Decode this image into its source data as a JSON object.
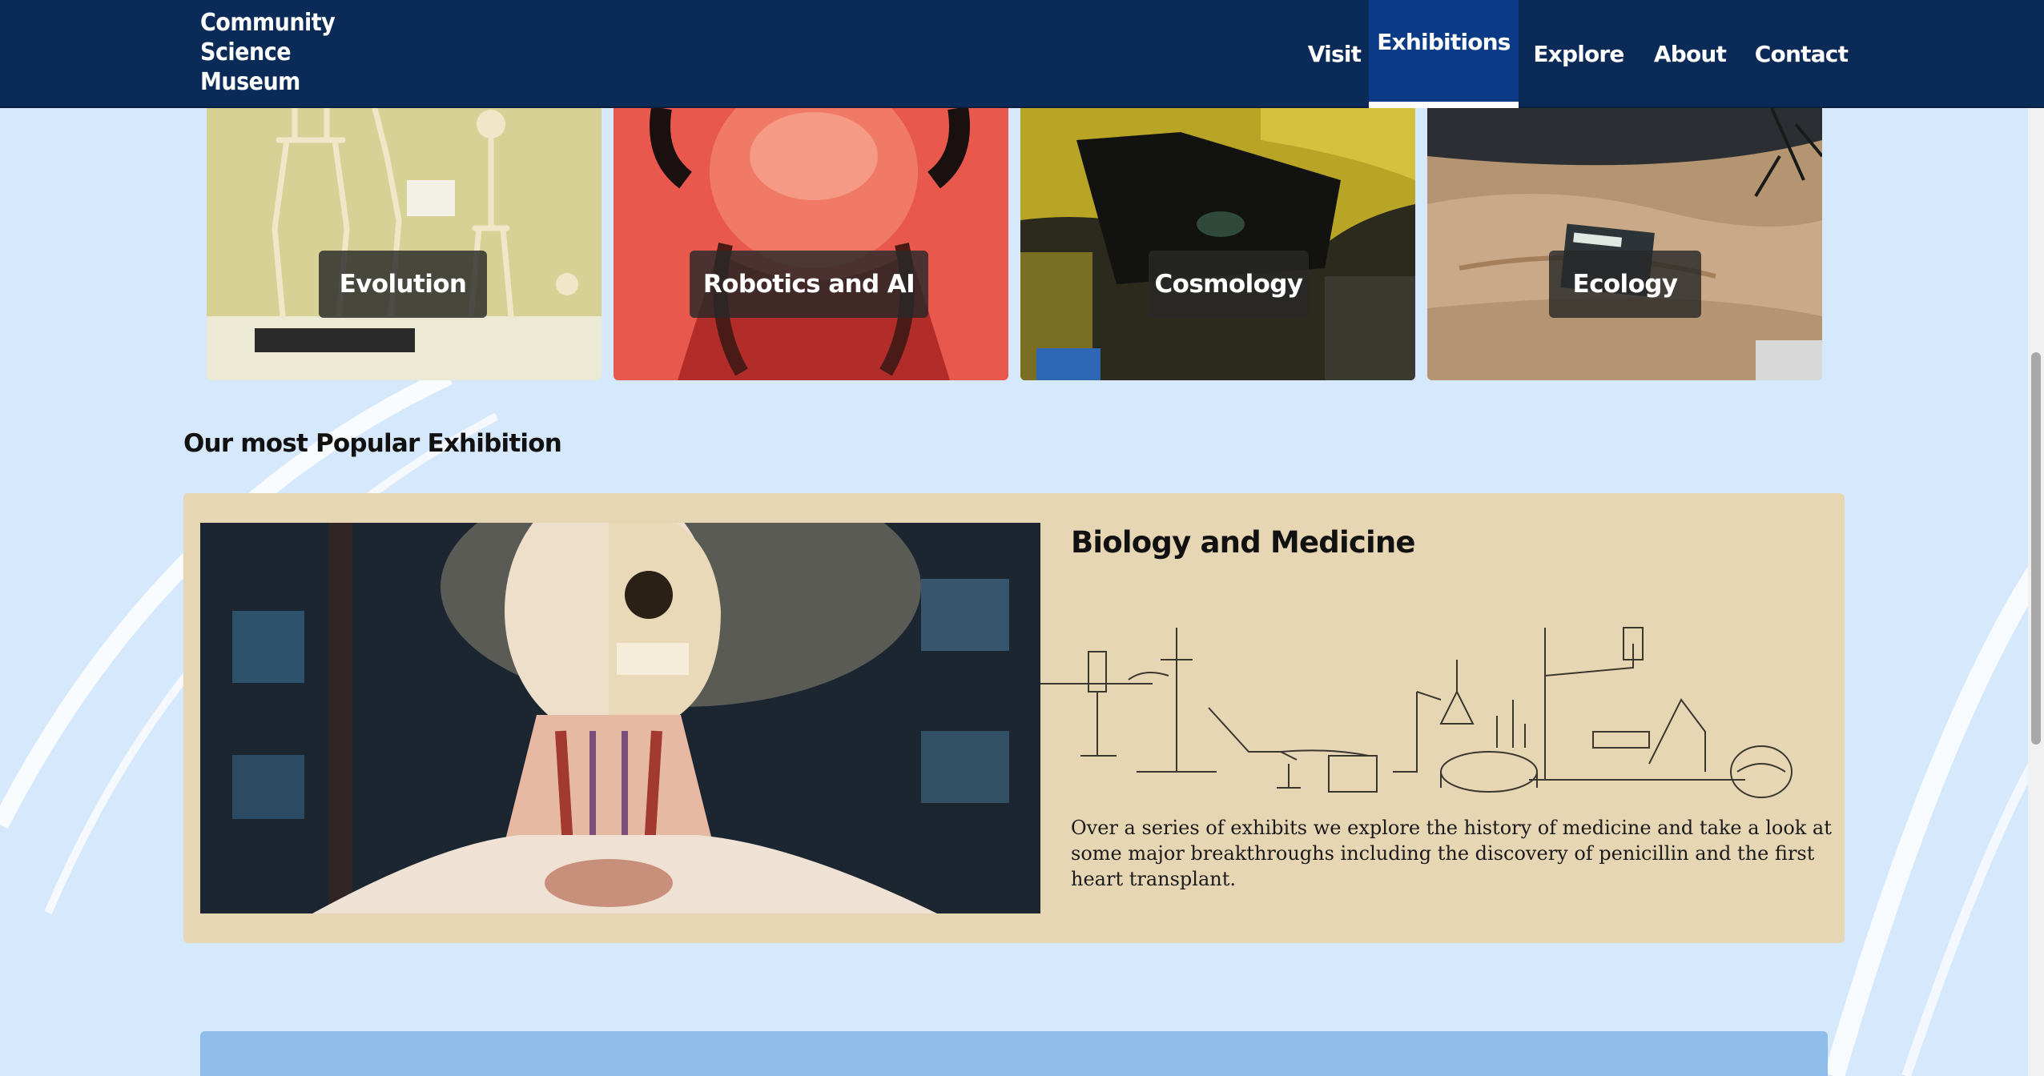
{
  "site": {
    "logo_line1": "Community",
    "logo_line2": "Science",
    "logo_line3": "Museum"
  },
  "nav": {
    "items": [
      {
        "label": "Visit"
      },
      {
        "label": "Exhibitions",
        "active": true
      },
      {
        "label": "Explore"
      },
      {
        "label": "About"
      },
      {
        "label": "Contact"
      }
    ]
  },
  "exhibitions": {
    "tiles": [
      {
        "label": "Evolution",
        "image": "skeletons"
      },
      {
        "label": "Robotics and AI",
        "image": "vr-headset-person"
      },
      {
        "label": "Cosmology",
        "image": "astronaut-suit"
      },
      {
        "label": "Ecology",
        "image": "sand-terrain-model"
      }
    ]
  },
  "popular": {
    "heading": "Our most Popular Exhibition",
    "card": {
      "title": "Biology and Medicine",
      "image": "anatomical-head-model",
      "illustration": "laboratory-apparatus",
      "description": "Over a series of exhibits we explore the history of medicine and take a look at some major breakthroughs including the discovery of penicillin and the first heart transplant."
    }
  },
  "colors": {
    "header": "#0a2a58",
    "nav_active": "#0b3b87",
    "page_bg": "#d6e8fb",
    "card_bg": "#e6d6b4",
    "bottom_panel": "#8fbde9"
  }
}
